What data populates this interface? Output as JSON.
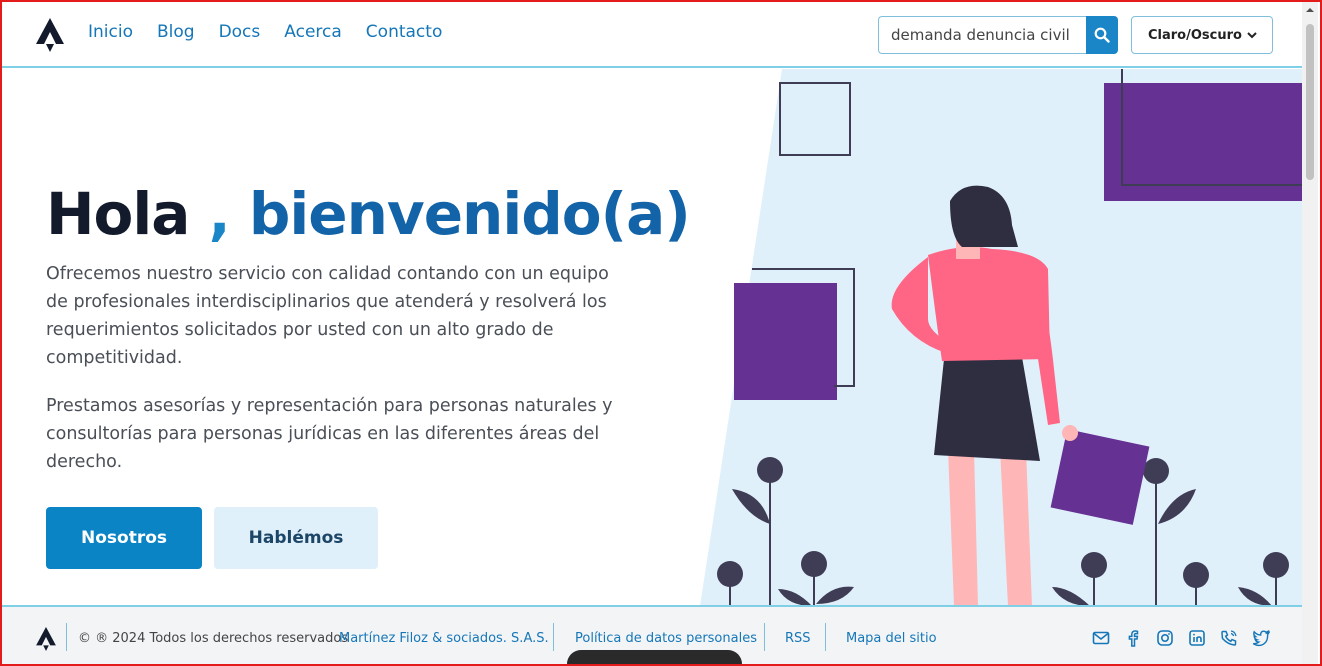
{
  "header": {
    "nav": [
      {
        "label": "Inicio"
      },
      {
        "label": "Blog"
      },
      {
        "label": "Docs"
      },
      {
        "label": "Acerca"
      },
      {
        "label": "Contacto"
      }
    ],
    "search": {
      "value": "demanda denuncia civil",
      "icon": "search-icon"
    },
    "theme_select": {
      "value": "Claro/Oscuro"
    }
  },
  "hero": {
    "title_hola": "Hola",
    "title_comma": ",",
    "title_welcome": "bienvenido(a)",
    "paragraph_1": "Ofrecemos nuestro servicio con calidad contando con un equipo de profesionales interdisciplinarios que atenderá y resolverá los requerimientos solicitados por usted con un alto grado de competitividad.",
    "paragraph_2": "Prestamos asesorías y representación para personas naturales y consultorías para personas jurídicas en las diferentes áreas del derecho.",
    "button_primary": "Nosotros",
    "button_secondary": "Hablémos"
  },
  "footer": {
    "copyright": "© ® 2024 Todos los derechos reservados",
    "company_link": "Martínez Filoz & sociados. S.A.S.",
    "privacy_link": "Política de datos personales",
    "rss_link": "RSS",
    "sitemap_link": "Mapa del sitio",
    "social_icons": [
      "mail-icon",
      "facebook-icon",
      "instagram-icon",
      "linkedin-icon",
      "phone-icon",
      "twitter-icon"
    ]
  },
  "colors": {
    "accent": "#1a85c7",
    "title_dark": "#121a2c",
    "title_blue": "#1263a8",
    "purple": "#653294",
    "illustration_bg": "#e0f0fb"
  }
}
